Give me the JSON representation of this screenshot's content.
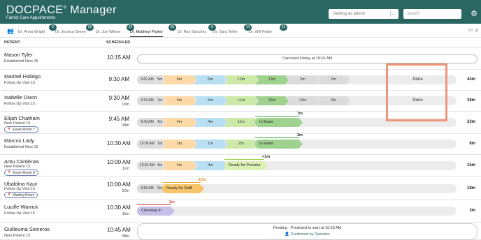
{
  "header": {
    "logo_text": "DOCPACE",
    "logo_reg": "®",
    "logo_suffix": " Manager",
    "subtitle": "Family Care Appointments",
    "viewing": "viewing as admin",
    "search_placeholder": "search"
  },
  "tabs": [
    {
      "label": "Dr. Anna Wright",
      "badge": "0"
    },
    {
      "label": "Dr. Jessica Green",
      "badge": "25"
    },
    {
      "label": "Dr. Joe Wilson",
      "badge": "23"
    },
    {
      "label": "Dr. Matthew Parker",
      "badge": "35"
    },
    {
      "label": "Dr. Ray Sanchez",
      "badge": "9"
    },
    {
      "label": "Dr. Sara Teller",
      "badge": "14"
    },
    {
      "label": "Dr. Will Fetter",
      "badge": "21"
    }
  ],
  "columns": {
    "patient": "PATIENT",
    "scheduled": "SCHEDULED"
  },
  "colors": {
    "teal": "#2a6763",
    "gray": "#dcdcdc",
    "orange": "#fcd9a6",
    "blue": "#b9dff2",
    "green": "#cde9a9",
    "ingreen": "#9fd18f",
    "purple": "#c7c0e6",
    "amber": "#f7c46a",
    "lime": "#dcf0b4",
    "box": "#f0957a"
  },
  "rows": [
    {
      "name": "Mason Tyler",
      "visit": "Established New 15",
      "time": "10:15 AM",
      "note": "Canceled Friday at 10:16 AM"
    },
    {
      "name": "Maribel Hidalgo",
      "visit": "Follow Up Visit 15",
      "time": "9:30 AM",
      "segs": [
        "9:00 AM",
        "5m",
        "5m",
        "5m",
        "12m",
        "13m",
        "3m",
        "2m"
      ],
      "done": "Done",
      "total": "44m"
    },
    {
      "name": "Isabelle Dixon",
      "visit": "Follow Up Visit 15",
      "time": "9:30 AM",
      "wait": "10m",
      "segs": [
        "9:33 AM",
        "1m",
        "5m",
        "5m",
        "<1m",
        "13m",
        "13m",
        "2m"
      ],
      "done": "Done",
      "total": "38m"
    },
    {
      "name": "Elijah Chatham",
      "visit": "New Patient 15",
      "room": "Exam Room 7",
      "time": "9:45 AM",
      "wait": "08m",
      "segs": [
        "9:43 AM",
        "4m",
        "4m",
        "4m",
        "11m"
      ],
      "status": "In Exam",
      "top": "7m",
      "total": "33m"
    },
    {
      "name": "Marcus Lady",
      "visit": "Established New 15",
      "time": "10:30 AM",
      "segs": [
        "10:08 AM",
        "1m",
        "1m",
        "1m",
        "2m"
      ],
      "status": "In Exam",
      "top": "3m",
      "total": "8m"
    },
    {
      "name": "Antu Cárdenas",
      "visit": "New Patient 15",
      "room": "Exam Room 8",
      "time": "10:00 AM",
      "wait": "11m",
      "segs": [
        "10:01 AM",
        "4m",
        "4m",
        "4m"
      ],
      "status": "Ready for Provider",
      "top": "<1m",
      "total": "15m"
    },
    {
      "name": "Ubaldina Kaur",
      "visit": "Follow Up Visit 15",
      "room": "Waiting Room",
      "time": "10:00 AM",
      "wait": "22m",
      "segs": [
        "9:58 AM",
        "6m"
      ],
      "status": "Ready for Staff",
      "top": "12m",
      "total": "18m"
    },
    {
      "name": "Lucille Warrick",
      "visit": "Follow Up Visit 15",
      "time": "10:30 AM",
      "wait": "11m",
      "status": "Checking In",
      "top": "3m",
      "total": "3m"
    },
    {
      "name": "Guilleuma Sisneros",
      "visit": "New Patient 15",
      "time": "10:45 AM",
      "wait": "08m",
      "pending": "Pending - Predicted to start at 10:53 AM",
      "confirmed": "Confirmed by Operator"
    }
  ]
}
